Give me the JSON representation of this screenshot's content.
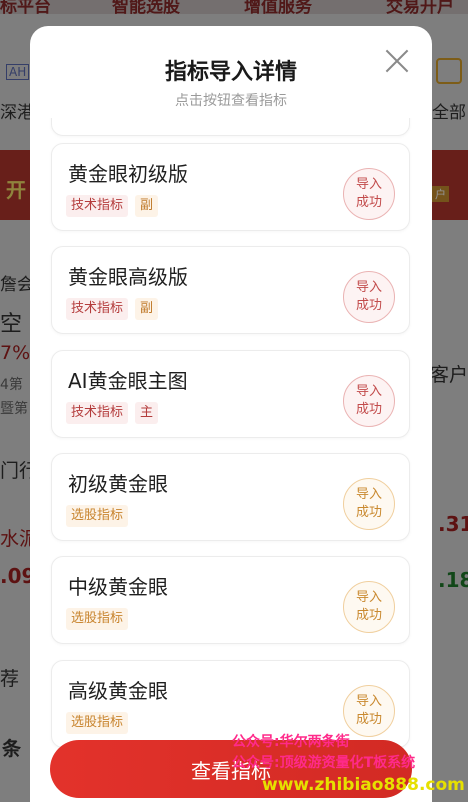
{
  "background": {
    "nav": [
      "标平台",
      "智能选股",
      "增值服务",
      "交易开户"
    ],
    "left_fragments": [
      "AH",
      "深港",
      "开",
      "詹会",
      "空",
      "7%",
      "4第",
      "暨第",
      "门行",
      "水泥",
      ".09",
      "荐",
      "条"
    ],
    "right_fragments": [
      "全部",
      "户",
      "客户",
      ".31",
      ".18"
    ]
  },
  "modal": {
    "title": "指标导入详情",
    "subtitle": "点击按钮查看指标",
    "items": [
      {
        "name": "黄金眼初级版",
        "tags": [
          "技术指标",
          "副"
        ],
        "status": [
          "导入",
          "成功"
        ],
        "tone": "red"
      },
      {
        "name": "黄金眼高级版",
        "tags": [
          "技术指标",
          "副"
        ],
        "status": [
          "导入",
          "成功"
        ],
        "tone": "red"
      },
      {
        "name": "AI黄金眼主图",
        "tags": [
          "技术指标",
          "主"
        ],
        "status": [
          "导入",
          "成功"
        ],
        "tone": "red"
      },
      {
        "name": "初级黄金眼",
        "tags": [
          "选股指标"
        ],
        "status": [
          "导入",
          "成功"
        ],
        "tone": "orange"
      },
      {
        "name": "中级黄金眼",
        "tags": [
          "选股指标"
        ],
        "status": [
          "导入",
          "成功"
        ],
        "tone": "orange"
      },
      {
        "name": "高级黄金眼",
        "tags": [
          "选股指标"
        ],
        "status": [
          "导入",
          "成功"
        ],
        "tone": "orange"
      }
    ],
    "button_label": "查看指标"
  },
  "watermark": {
    "line1": "公众号:华尔两条街",
    "line2": "公众号:顶级游资量化T板系统",
    "line3": "www.zhibiao888.com"
  },
  "icons": {
    "close": "close-icon"
  }
}
